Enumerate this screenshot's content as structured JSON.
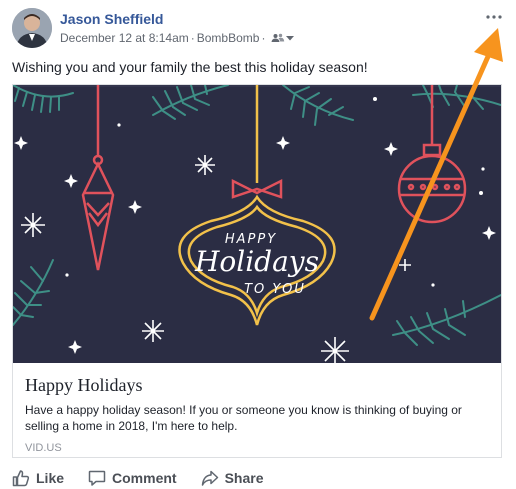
{
  "post": {
    "author": "Jason Sheffield",
    "timestamp": "December 12 at 8:14am",
    "separator": "·",
    "via": "BombBomb",
    "audience_icon": "friends-icon",
    "text": "Wishing you and your family the best this holiday season!"
  },
  "card": {
    "image_text_top": "HAPPY",
    "image_text_main": "Holidays",
    "image_text_bottom": "TO YOU",
    "title": "Happy Holidays",
    "description": "Have a happy holiday season! If you or someone you know is thinking of buying or selling a home in 2018, I'm here to help.",
    "domain": "VID.US"
  },
  "actions": {
    "like": "Like",
    "comment": "Comment",
    "share": "Share"
  },
  "colors": {
    "author_link": "#365899",
    "image_bg": "#2b2d44",
    "neon_gold": "#f2c14a",
    "neon_red": "#e0525c",
    "pine": "#3e8f86",
    "annotation_arrow": "#f7941e"
  }
}
